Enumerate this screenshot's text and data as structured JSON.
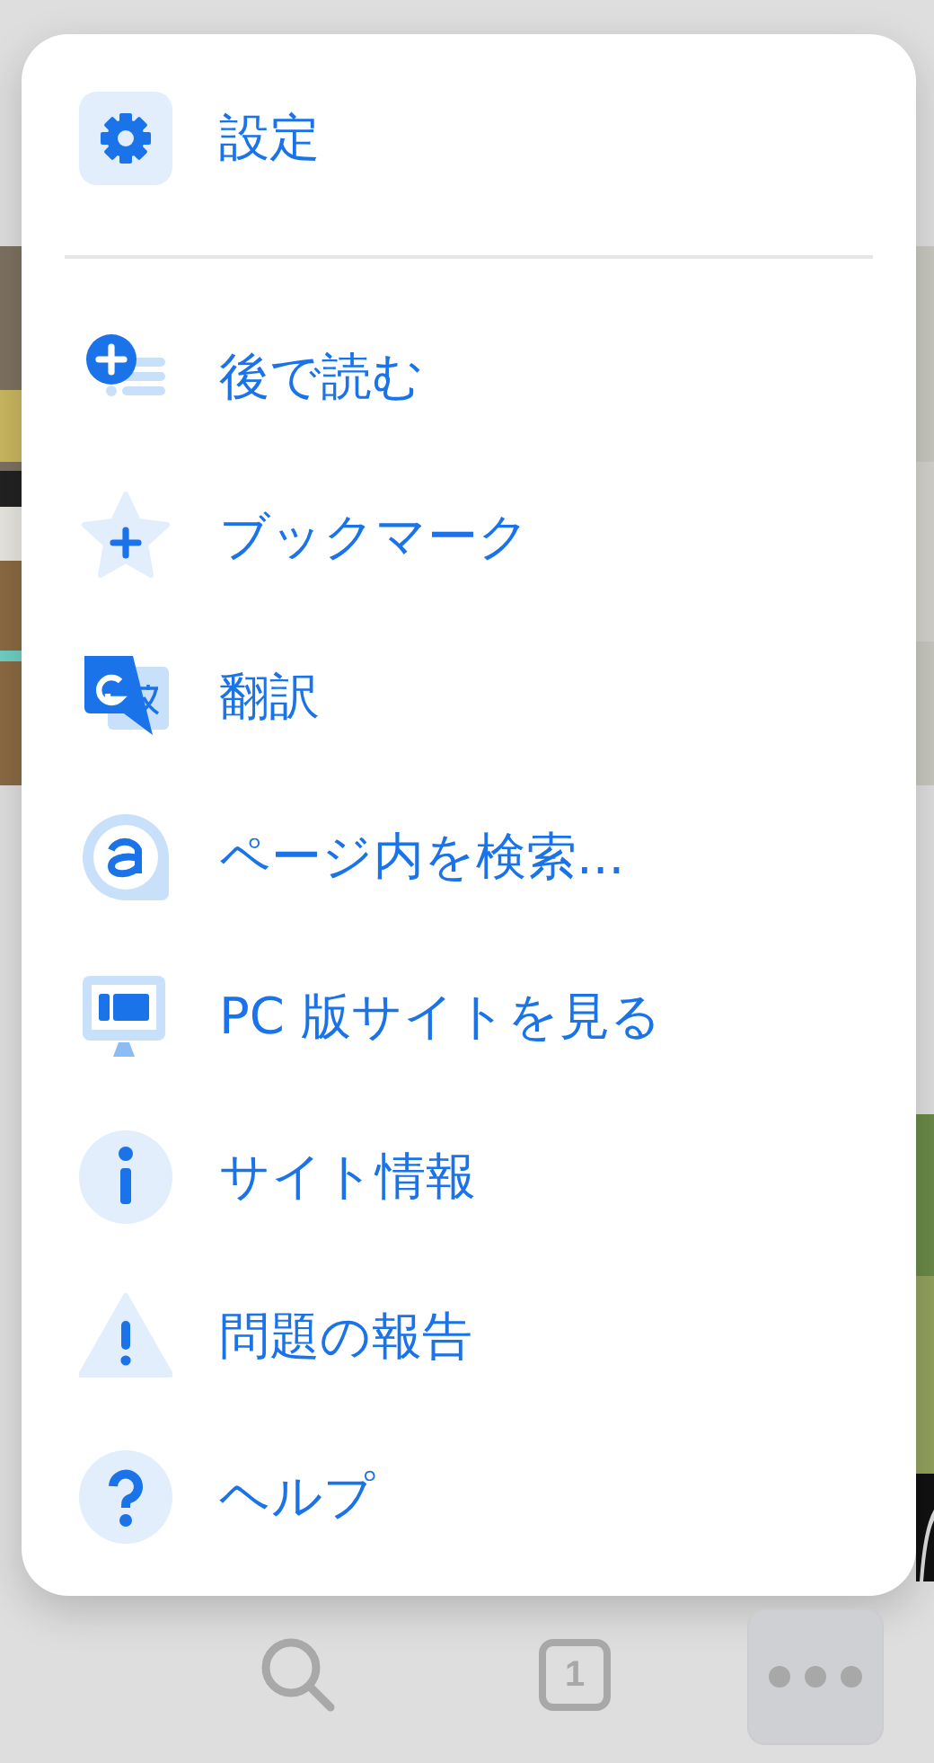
{
  "menu": {
    "header_item": {
      "label": "設定",
      "kind": "settings"
    },
    "items": [
      {
        "label": "後で読む",
        "kind": "read-later"
      },
      {
        "label": "ブックマーク",
        "kind": "bookmark"
      },
      {
        "label": "翻訳",
        "kind": "translate"
      },
      {
        "label": "ページ内を検索...",
        "kind": "find"
      },
      {
        "label": "PC 版サイトを見る",
        "kind": "desktop"
      },
      {
        "label": "サイト情報",
        "kind": "info"
      },
      {
        "label": "問題の報告",
        "kind": "report"
      },
      {
        "label": "ヘルプ",
        "kind": "help"
      }
    ]
  },
  "toolbar": {
    "buttons": [
      {
        "kind": "search",
        "selected": false
      },
      {
        "kind": "tabs",
        "label": "1",
        "selected": false
      },
      {
        "kind": "more",
        "selected": true
      }
    ]
  }
}
